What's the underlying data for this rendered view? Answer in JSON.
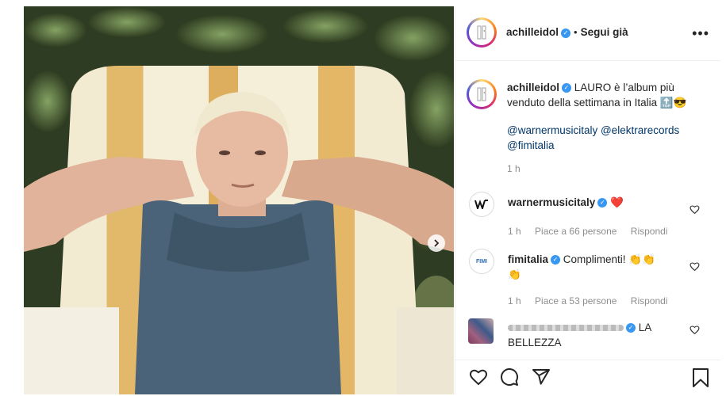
{
  "post": {
    "author": "achilleidol",
    "follow_status": "Segui già",
    "caption_text": "LAURO è l’album più venduto della settimana in Italia",
    "caption_emojis": "🔝😎",
    "mentions_line1": "@warnermusicitaly @elektrarecords",
    "mentions_line2": "@fimitalia",
    "caption_time": "1 h"
  },
  "comments": [
    {
      "username": "warnermusicitaly",
      "text": "❤️",
      "time": "1 h",
      "likes": "Piace a 66 persone",
      "reply": "Rispondi"
    },
    {
      "username": "fimitalia",
      "text": "Complimenti! 👏👏",
      "text_line2": "👏",
      "time": "1 h",
      "likes": "Piace a 53 persone",
      "reply": "Rispondi"
    },
    {
      "username": "",
      "text": "LA",
      "text_line2": "BELLEZZA"
    }
  ],
  "icons": {
    "more": "more-options-icon",
    "like": "heart-icon",
    "comment": "comment-icon",
    "share": "share-icon",
    "save": "bookmark-icon",
    "next": "chevron-right-icon"
  },
  "colors": {
    "verified": "#3897f0",
    "heart": "#ed4956",
    "link": "#00376b"
  }
}
